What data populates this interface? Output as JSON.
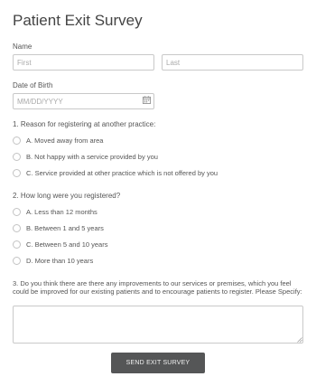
{
  "form": {
    "title": "Patient Exit Survey",
    "name": {
      "label": "Name",
      "first_placeholder": "First",
      "last_placeholder": "Last"
    },
    "dob": {
      "label": "Date of Birth",
      "placeholder": "MM/DD/YYYY",
      "icon": "calendar-icon"
    },
    "q1": {
      "question": "1. Reason for registering at another practice:",
      "options": [
        "A. Moved away from area",
        "B. Not happy with a service provided by you",
        "C. Service provided at other practice which is not offered by you"
      ]
    },
    "q2": {
      "question": "2. How long were you registered?",
      "options": [
        "A. Less than 12 months",
        "B. Between 1 and 5 years",
        "C. Between 5 and 10 years",
        "D. More than 10 years"
      ]
    },
    "q3": {
      "question": "3. Do you think there are there any improvements to our services or premises, which you feel could be improved for our existing patients and to encourage patients to register. Please Specify:",
      "value": ""
    },
    "submit_label": "SEND EXIT SURVEY"
  },
  "colors": {
    "button_bg": "#555657",
    "border": "#c9c9c9",
    "text": "#555555"
  }
}
